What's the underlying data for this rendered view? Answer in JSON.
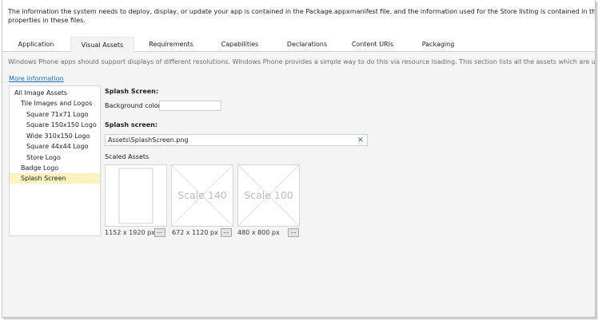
{
  "info": {
    "line1": "The information the system needs to deploy, display, or update your app is contained in the Package.appxmanifest file, and the information used for the Store listing is contained in the StoreManifest.xml file. You can u",
    "line2": "properties in these files."
  },
  "tabs": [
    "Application",
    "Visual Assets",
    "Requirements",
    "Capabilities",
    "Declarations",
    "Content URIs",
    "Packaging"
  ],
  "active_tab": "Visual Assets",
  "description": "Windows Phone apps should support displays of different resolutions. Windows Phone provides a simple way to do this via resource loading. This section lists all the assets which are used in the manifest.",
  "more_info": "More information",
  "tree": {
    "items": [
      {
        "label": "All Image Assets",
        "level": 0
      },
      {
        "label": "Tile Images and Logos",
        "level": 1
      },
      {
        "label": "Square 71x71 Logo",
        "level": 2
      },
      {
        "label": "Square 150x150 Logo",
        "level": 2
      },
      {
        "label": "Wide 310x150 Logo",
        "level": 2
      },
      {
        "label": "Square 44x44 Logo",
        "level": 2
      },
      {
        "label": "Store Logo",
        "level": 2
      },
      {
        "label": "Badge Logo",
        "level": 1
      },
      {
        "label": "Splash Screen",
        "level": 1,
        "selected": true
      }
    ]
  },
  "detail": {
    "section_title": "Splash Screen:",
    "bg_color_label": "Background color:",
    "bg_color_value": "",
    "splash_label": "Splash screen:",
    "splash_path": "Assets\\SplashScreen.png",
    "clear_icon": "×",
    "scaled_label": "Scaled Assets",
    "assets": [
      {
        "scale_text": "",
        "size": "1152 x 1920 px",
        "browse": "..."
      },
      {
        "scale_text": "Scale 140",
        "size": "672 x 1120 px",
        "browse": "..."
      },
      {
        "scale_text": "Scale 100",
        "size": "480 x 800 px",
        "browse": "..."
      }
    ]
  },
  "colors": {
    "selection": "#fff3c2",
    "link": "#1e6fc7",
    "border": "#d6d6d6"
  }
}
